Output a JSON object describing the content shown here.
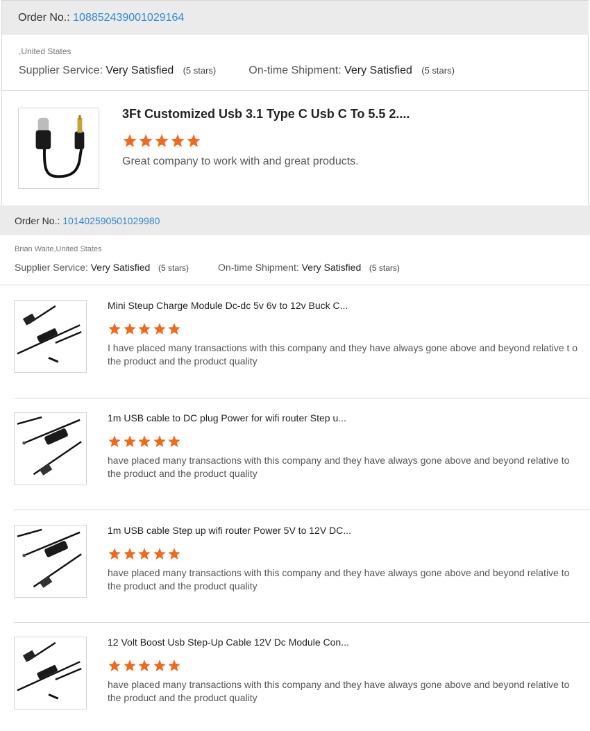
{
  "orders": [
    {
      "order_label": "Order No.:",
      "order_number": "108852439001029164",
      "buyer_location": ",United States",
      "supplier_service_label": "Supplier Service:",
      "supplier_service_value": "Very Satisfied",
      "supplier_service_stars": "(5 stars)",
      "shipment_label": "On-time Shipment:",
      "shipment_value": "Very Satisfied",
      "shipment_stars": "(5 stars)",
      "items": [
        {
          "title": "3Ft Customized Usb 3.1 Type C Usb C To 5.5 2....",
          "rating": 5,
          "review": "Great company to work with and great products.",
          "image": "usb-c-to-dc-cable"
        }
      ]
    },
    {
      "order_label": "Order No.:",
      "order_number": "101402590501029980",
      "buyer_location": "Brian Waite,United States",
      "supplier_service_label": "Supplier Service:",
      "supplier_service_value": "Very Satisfied",
      "supplier_service_stars": "(5 stars)",
      "shipment_label": "On-time Shipment:",
      "shipment_value": "Very Satisfied",
      "shipment_stars": "(5 stars)",
      "items": [
        {
          "title": "Mini Steup Charge Module Dc-dc 5v 6v to 12v Buck C...",
          "rating": 5,
          "review": "I have placed many transactions with this company and they have always gone above and beyond relative t o the product and the product quality",
          "image": "usb-step-up-cable"
        },
        {
          "title": "1m USB cable to DC plug Power for wifi router Step u...",
          "rating": 5,
          "review": "have placed many transactions with this company and they have always gone above and beyond relative to the product and the product quality",
          "image": "usb-dc-cable-module"
        },
        {
          "title": "1m USB cable Step up wifi router Power 5V to 12V DC...",
          "rating": 5,
          "review": "have placed many transactions with this company and they have always gone above and beyond relative to the product and the product quality",
          "image": "usb-dc-cable-module"
        },
        {
          "title": "12 Volt Boost Usb Step-Up Cable 12V Dc Module Con...",
          "rating": 5,
          "review": "have placed many transactions with this company and they have always gone above and beyond relative to the product and the product quality",
          "image": "usb-step-up-cable"
        }
      ]
    }
  ],
  "colors": {
    "star": "#f06a1d",
    "link": "#2f87d4",
    "header_bg": "#ebebeb"
  }
}
